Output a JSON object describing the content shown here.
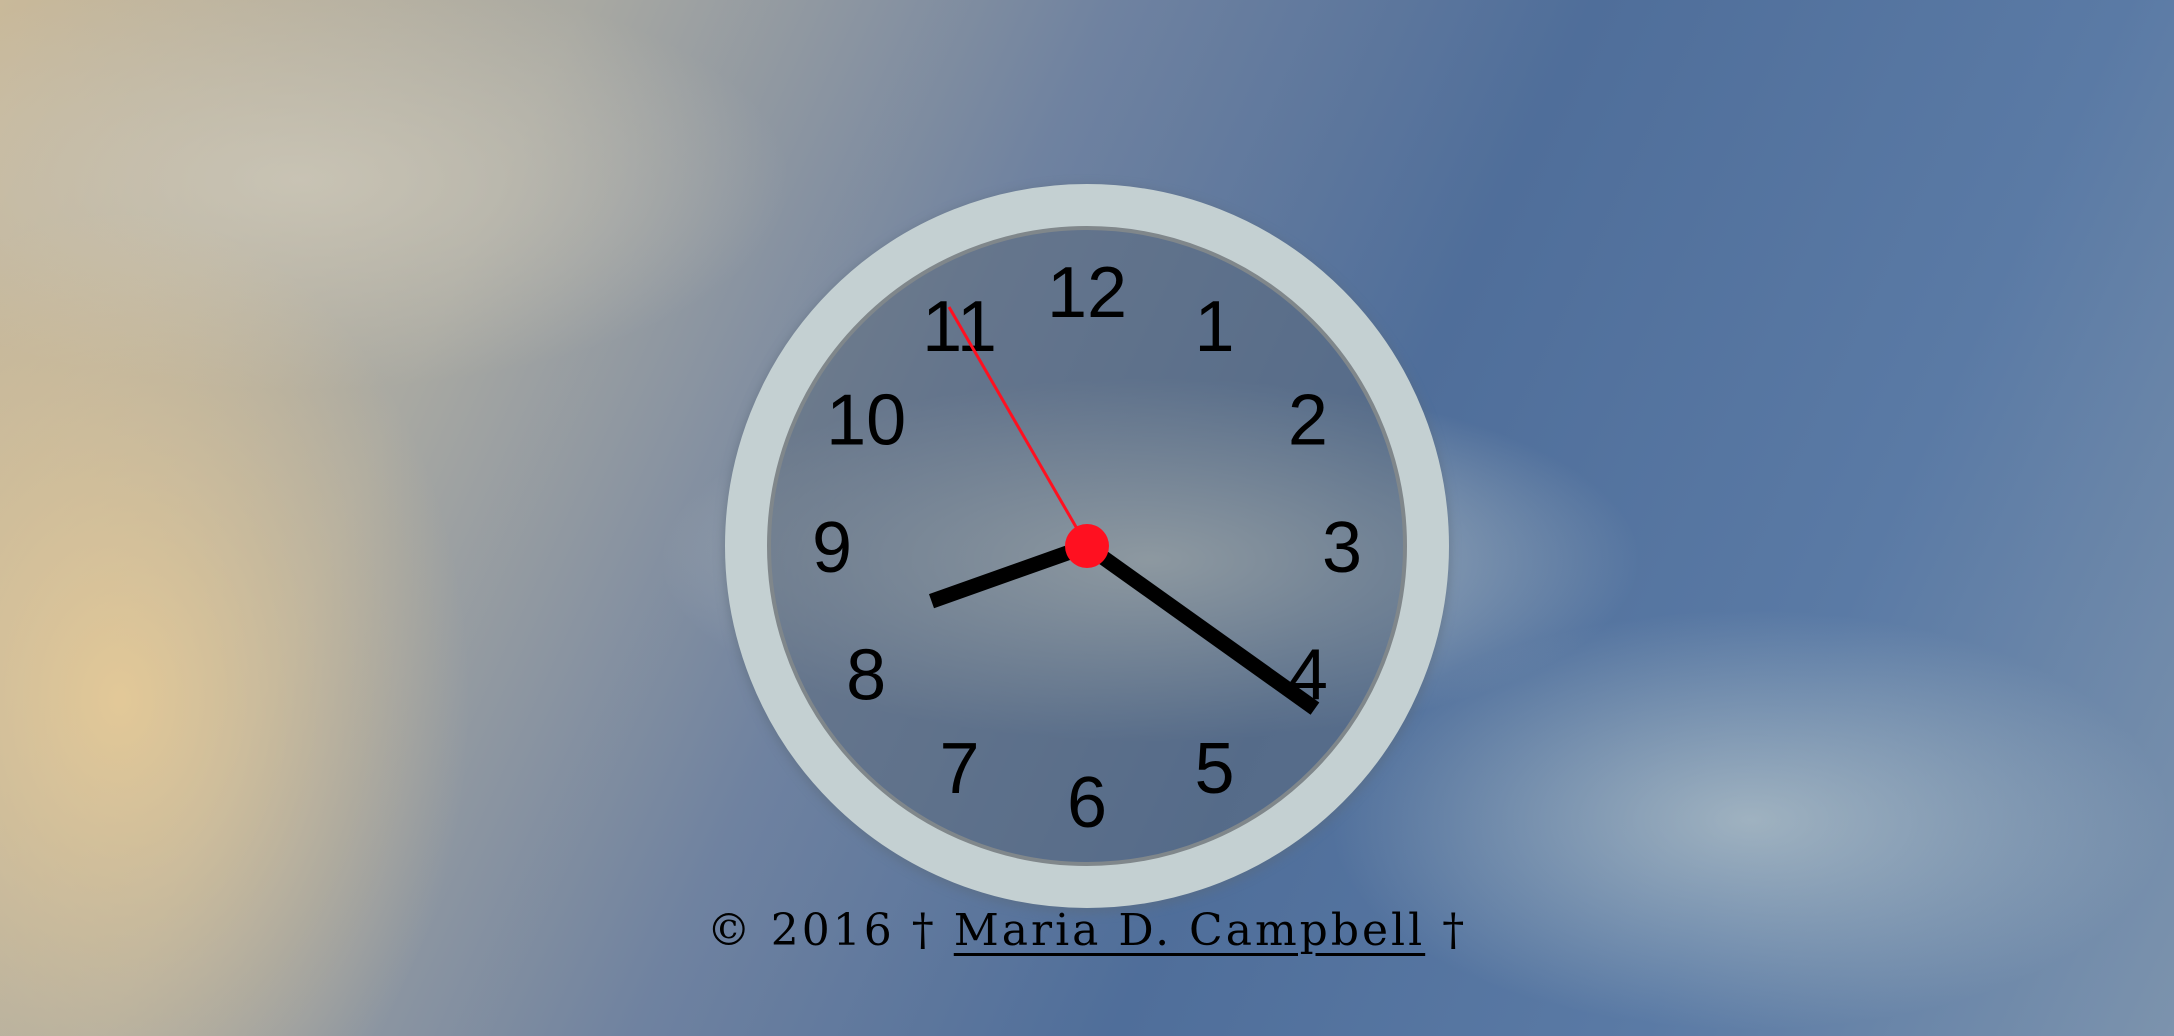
{
  "clock": {
    "numbers": [
      "12",
      "1",
      "2",
      "3",
      "4",
      "5",
      "6",
      "7",
      "8",
      "9",
      "10",
      "11"
    ],
    "time": {
      "hours": 8,
      "minutes": 20,
      "seconds": 55
    },
    "colors": {
      "ring": "#c4d0d2",
      "ring_edge": "#7f8589",
      "hands": "#000000",
      "second_hand": "#ff1020",
      "hub": "#ff1020"
    }
  },
  "footer": {
    "copyright": "© 2016 †",
    "author_link": "Maria D. Campbell",
    "trailing": "†"
  }
}
